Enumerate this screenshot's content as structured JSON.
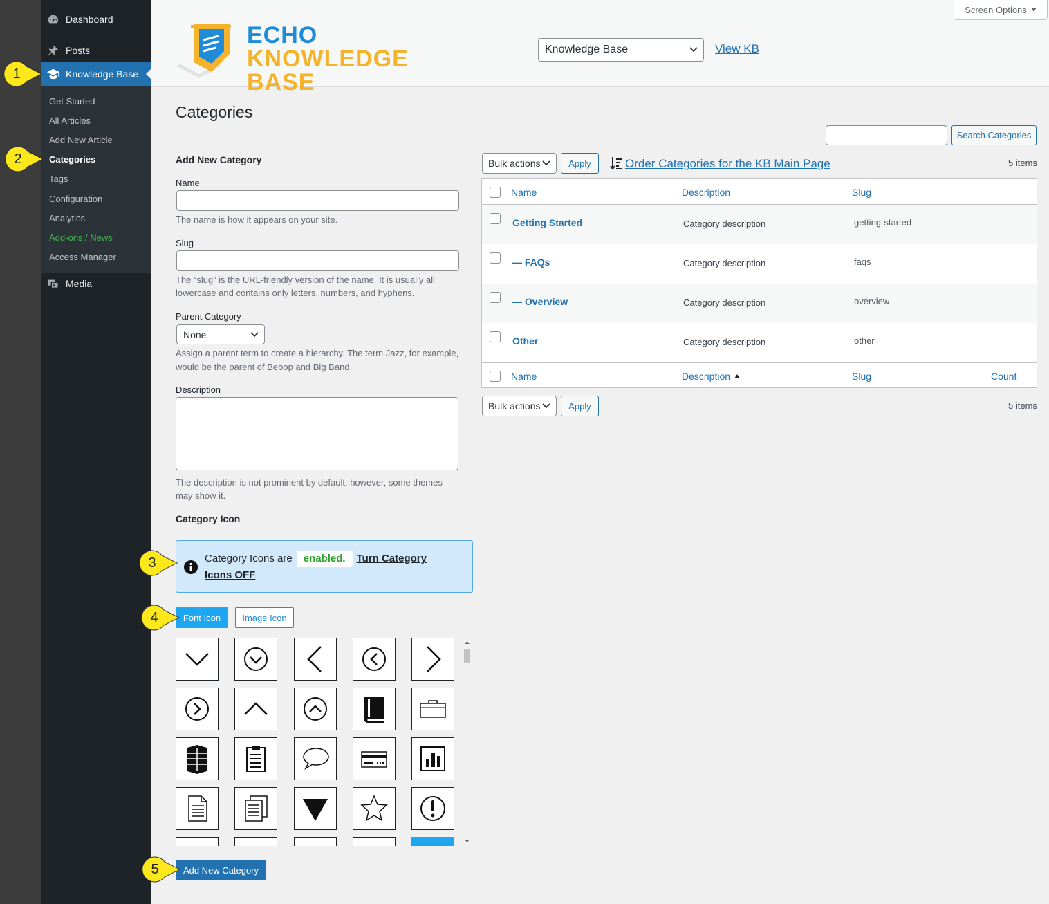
{
  "sidebar": {
    "dashboard": "Dashboard",
    "posts": "Posts",
    "knowledge_base": "Knowledge Base",
    "media": "Media",
    "submenu": [
      "Get Started",
      "All Articles",
      "Add New Article",
      "Categories",
      "Tags",
      "Configuration",
      "Analytics",
      "Add-ons / News",
      "Access Manager"
    ]
  },
  "header": {
    "logo_line1": "ECHO",
    "logo_line2": "KNOWLEDGE BASE",
    "kb_select": "Knowledge Base",
    "view_kb": "View KB",
    "screen_options": "Screen Options"
  },
  "page": {
    "title": "Categories"
  },
  "form": {
    "heading": "Add New Category",
    "name_label": "Name",
    "name_help": "The name is how it appears on your site.",
    "slug_label": "Slug",
    "slug_help_1": "The “slug” is the URL-friendly version of the name. It is usually all",
    "slug_help_2": "lowercase and contains only letters, numbers, and hyphens.",
    "parent_label": "Parent Category",
    "parent_value": "None",
    "parent_help_1": "Assign a parent term to create a hierarchy. The term Jazz, for example,",
    "parent_help_2": "would be the parent of Bebop and Big Band.",
    "desc_label": "Description",
    "desc_help_1": "The description is not prominent by default; however, some themes",
    "desc_help_2": "may show it.",
    "icon_heading": "Category Icon",
    "notice_prefix": "Category Icons are",
    "notice_status": "enabled.",
    "notice_link": "Turn Category Icons OFF",
    "tab_font": "Font Icon",
    "tab_image": "Image Icon",
    "submit": "Add New Category"
  },
  "table": {
    "search_button": "Search Categories",
    "bulk_actions": "Bulk actions",
    "apply": "Apply",
    "order_link": "Order Categories for the KB Main Page",
    "items_count": "5 items",
    "col_name": "Name",
    "col_description": "Description",
    "col_slug": "Slug",
    "col_count": "Count",
    "rows": [
      {
        "name": "Getting Started",
        "description": "Category description",
        "slug": "getting-started"
      },
      {
        "name": "— FAQs",
        "description": "Category description",
        "slug": "faqs"
      },
      {
        "name": "— Overview",
        "description": "Category description",
        "slug": "overview"
      },
      {
        "name": "Other",
        "description": "Category description",
        "slug": "other"
      }
    ]
  },
  "callouts": [
    "1",
    "2",
    "3",
    "4",
    "5"
  ],
  "colors": {
    "admin_blue": "#2271b1",
    "sidebar": "#1d2327",
    "callout_yellow": "#fde81b",
    "logo_blue": "#1e8cd8",
    "logo_gold": "#f4b32a",
    "addon_green": "#46b450"
  }
}
